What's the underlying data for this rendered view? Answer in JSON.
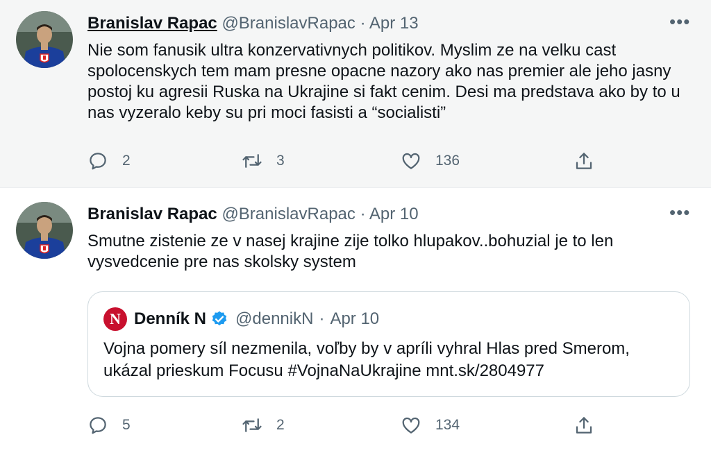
{
  "colors": {
    "text": "#0f1419",
    "secondary": "#536471",
    "verified": "#1d9bf0",
    "dennik_n_brand": "#c8102e",
    "highlight_bg": "#f5f6f6"
  },
  "tweets": [
    {
      "author": "Branislav Rapac",
      "handle": "@BranislavRapac",
      "separator": "·",
      "date": "Apr 13",
      "more": "•••",
      "text": "Nie som fanusik ultra konzervativnych politikov. Myslim ze na velku cast spolocenskych tem mam presne opacne nazory ako nas premier ale jeho jasny postoj ku agresii Ruska na Ukrajine si fakt cenim. Desi ma predstava ako by to u nas vyzeralo keby su pri moci fasisti a “socialisti”",
      "replies": "2",
      "retweets": "3",
      "likes": "136",
      "icons": [
        "reply-icon",
        "retweet-icon",
        "like-icon",
        "share-icon"
      ]
    },
    {
      "author": "Branislav Rapac",
      "handle": "@BranislavRapac",
      "separator": "·",
      "date": "Apr 10",
      "more": "•••",
      "text": "Smutne zistenie ze v nasej krajine zije tolko hlupakov..bohuzial je to len vysvedcenie pre nas skolsky system",
      "quote": {
        "logo_letter": "N",
        "author": "Denník N",
        "handle": "@dennikN",
        "separator": "·",
        "date": "Apr 10",
        "text": "Vojna pomery síl nezmenila, voľby by v apríli vyhral Hlas pred Smerom, ukázal prieskum Focusu #VojnaNaUkrajine mnt.sk/2804977"
      },
      "replies": "5",
      "retweets": "2",
      "likes": "134",
      "icons": [
        "reply-icon",
        "retweet-icon",
        "like-icon",
        "share-icon"
      ]
    }
  ]
}
